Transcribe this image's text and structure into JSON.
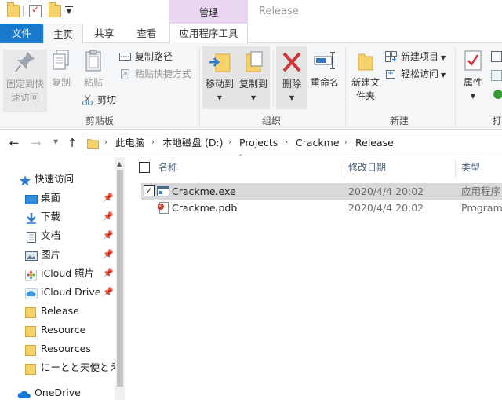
{
  "titlebar": {
    "manage_tab": "管理",
    "title": "Release"
  },
  "tabs": {
    "file": "文件",
    "home": "主页",
    "share": "共享",
    "view": "查看",
    "app_tools": "应用程序工具"
  },
  "ribbon": {
    "pin_quick_access": "固定到快速访问",
    "copy": "复制",
    "paste": "粘贴",
    "copy_path": "复制路径",
    "paste_shortcut": "粘贴快捷方式",
    "cut": "剪切",
    "clipboard_group": "剪贴板",
    "move_to": "移动到",
    "copy_to": "复制到",
    "delete": "删除",
    "rename": "重命名",
    "organize_group": "组织",
    "new_folder": "新建文件夹",
    "new_item": "新建项目",
    "easy_access": "轻松访问",
    "new_group": "新建",
    "properties": "属性",
    "open_group_partial": "打"
  },
  "address": {
    "crumbs": [
      "此电脑",
      "本地磁盘 (D:)",
      "Projects",
      "Crackme",
      "Release"
    ]
  },
  "nav": {
    "quick_access": "快速访问",
    "items": [
      "桌面",
      "下载",
      "文档",
      "图片",
      "iCloud 照片",
      "iCloud Drive",
      "Release",
      "Resource",
      "Resources",
      "にーとと天使とえ"
    ],
    "onedrive": "OneDrive"
  },
  "columns": {
    "name": "名称",
    "date": "修改日期",
    "type": "类型"
  },
  "files": [
    {
      "name": "Crackme.exe",
      "date": "2020/4/4 20:02",
      "type": "应用程序",
      "selected": true
    },
    {
      "name": "Crackme.pdb",
      "date": "2020/4/4 20:02",
      "type": "Program",
      "selected": false
    }
  ],
  "colors": {
    "file_tab": "#1979ca",
    "manage_tab": "#e9d5f2",
    "ribbon_bg": "#f5f6f7",
    "selection": "#d9d9d9",
    "delete_red": "#d13438"
  }
}
